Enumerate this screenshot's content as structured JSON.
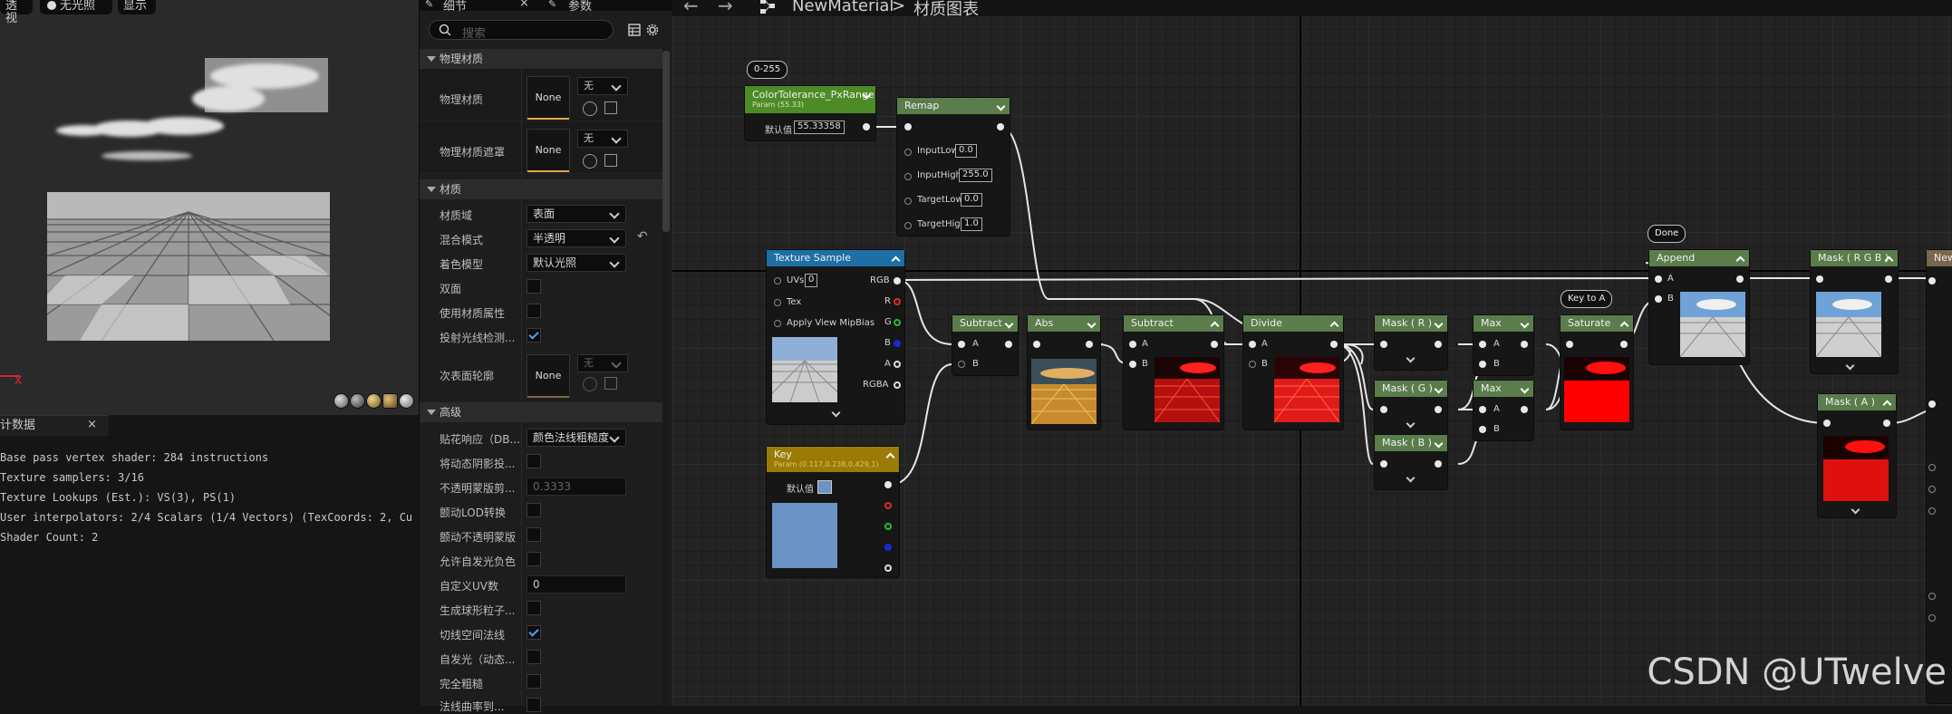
{
  "viewport": {
    "buttons": [
      "透视",
      "无光照",
      "显示"
    ],
    "axis_label": "X"
  },
  "stats": {
    "tab_title": "计数据",
    "close": "×",
    "lines": [
      "Base pass vertex shader: 284 instructions",
      "Texture samplers: 3/16",
      "Texture Lookups (Est.): VS(3), PS(1)",
      "User interpolators: 2/4 Scalars (1/4 Vectors) (TexCoords: 2, Cu",
      "Shader Count: 2"
    ]
  },
  "details": {
    "tabs": [
      "细节",
      "参数"
    ],
    "tab_close": "×",
    "search_placeholder": "搜索",
    "categories": {
      "physical": "物理材质",
      "material": "材质",
      "advanced": "高级"
    },
    "physical": [
      {
        "label": "物理材质",
        "asset": "None",
        "dropdown": "无"
      },
      {
        "label": "物理材质遮罩",
        "asset": "None",
        "dropdown": "无"
      }
    ],
    "material": {
      "domain": {
        "label": "材质域",
        "value": "表面"
      },
      "blend": {
        "label": "混合模式",
        "value": "半透明"
      },
      "shading": {
        "label": "着色模型",
        "value": "默认光照"
      },
      "two_sided": {
        "label": "双面",
        "checked": false
      },
      "use_attrs": {
        "label": "使用材质属性",
        "checked": false
      },
      "cast_rt": {
        "label": "投射光线检测...",
        "checked": true
      },
      "subsurface": {
        "label": "次表面轮廓",
        "asset": "None",
        "dropdown": "无"
      }
    },
    "advanced": {
      "decal": {
        "label": "贴花响应（DB...",
        "value": "颜色法线粗糙度"
      },
      "dyn_shadow": {
        "label": "将动态阴影投...",
        "checked": false
      },
      "opacity_clip": {
        "label": "不透明蒙版剪...",
        "value": "0.3333"
      },
      "dither_lod": {
        "label": "颤动LOD转换",
        "checked": false
      },
      "dither_opacity": {
        "label": "颤动不透明蒙版",
        "checked": false
      },
      "neg_emissive": {
        "label": "允许自发光负色",
        "checked": false
      },
      "custom_uv": {
        "label": "自定义UV数",
        "value": "0"
      },
      "sphere_particle": {
        "label": "生成球形粒子...",
        "checked": false
      },
      "tangent_normal": {
        "label": "切线空间法线",
        "checked": true
      },
      "emissive_dyn": {
        "label": "自发光（动态...",
        "checked": false
      },
      "full_rough": {
        "label": "完全粗糙",
        "checked": false
      },
      "last": {
        "label": "法线曲率到..."
      }
    }
  },
  "graph": {
    "breadcrumb": {
      "asset": "NewMaterial",
      "sep": ">",
      "page": "材质图表"
    },
    "badges": {
      "range": "0-255",
      "done": "Done",
      "key_to_a": "Key to A"
    },
    "nodes": {
      "param1": {
        "title": "ColorTolerance_PxRange",
        "sub": "Param (55.33)",
        "label": "默认值",
        "value": "55.33358"
      },
      "remap": {
        "title": "Remap",
        "pins": [
          "InputLow",
          "InputHigh",
          "TargetLow",
          "TargetHigh"
        ],
        "values": [
          "0.0",
          "255.0",
          "0.0",
          "1.0"
        ]
      },
      "texture": {
        "title": "Texture Sample",
        "inputs": [
          "UVs",
          "Tex",
          "Apply View MipBias"
        ],
        "uv_value": "0",
        "outputs": [
          "RGB",
          "R",
          "G",
          "B",
          "A",
          "RGBA"
        ]
      },
      "key": {
        "title": "Key",
        "sub": "Param (0.117,0.238,0.429,1)",
        "label": "默认值",
        "color": "#6b93c5"
      },
      "subtract1": {
        "title": "Subtract",
        "pins": [
          "A",
          "B"
        ]
      },
      "abs": {
        "title": "Abs"
      },
      "subtract2": {
        "title": "Subtract",
        "pins": [
          "A",
          "B"
        ]
      },
      "divide": {
        "title": "Divide",
        "pins": [
          "A",
          "B"
        ]
      },
      "mask_r": {
        "title": "Mask ( R )"
      },
      "mask_g": {
        "title": "Mask ( G )"
      },
      "mask_b": {
        "title": "Mask ( B )"
      },
      "max1": {
        "title": "Max",
        "pins": [
          "A",
          "B"
        ]
      },
      "max2": {
        "title": "Max",
        "pins": [
          "A",
          "B"
        ]
      },
      "saturate": {
        "title": "Saturate"
      },
      "append": {
        "title": "Append",
        "pins": [
          "A",
          "B"
        ]
      },
      "mask_rgb": {
        "title": "Mask ( R G B )"
      },
      "mask_a": {
        "title": "Mask ( A )"
      },
      "result": {
        "title": "New"
      }
    }
  },
  "watermark": "CSDN @UTwelve",
  "colors": {
    "accent_check": "#4da0ff",
    "asset_underline": "#e0a84c",
    "node_green": "#5a7d4b",
    "node_blue": "#1d6fa5",
    "node_gold": "#9a7b06"
  }
}
